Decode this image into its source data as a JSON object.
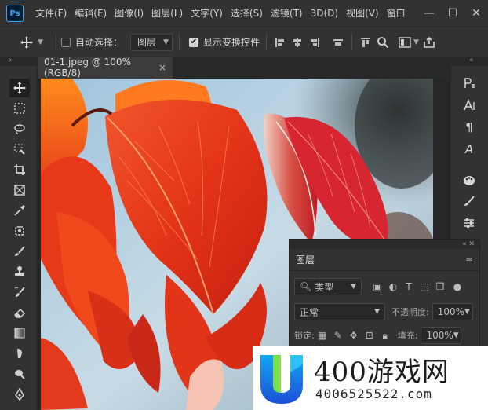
{
  "app": {
    "logo": "Ps"
  },
  "menu": [
    "文件(F)",
    "编辑(E)",
    "图像(I)",
    "图层(L)",
    "文字(Y)",
    "选择(S)",
    "滤镜(T)",
    "3D(D)",
    "视图(V)",
    "窗口"
  ],
  "window": {
    "minimize": "—",
    "restore": "☐",
    "close": "✕"
  },
  "options": {
    "auto_select_label": "自动选择：",
    "auto_select_checked": false,
    "auto_select_target": "图层",
    "show_transform_label": "显示变换控件",
    "show_transform_checked": true
  },
  "document": {
    "tab_title": "01-1.jpeg @ 100%(RGB/8)",
    "close": "×"
  },
  "layers_panel": {
    "title": "图层",
    "filter_kind": "类型",
    "blend_mode": "正常",
    "opacity_label": "不透明度:",
    "opacity_value": "100%",
    "lock_label": "锁定:",
    "fill_label": "填充:",
    "fill_value": "100%"
  },
  "watermark": {
    "brand": "400游戏网",
    "url": "4006525522.com"
  },
  "icons": {
    "tools": [
      "move-icon",
      "marquee-icon",
      "lasso-icon",
      "quick-select-icon",
      "crop-icon",
      "frame-icon",
      "eyedropper-icon",
      "patch-icon",
      "brush-icon",
      "stamp-icon",
      "history-brush-icon",
      "eraser-icon",
      "gradient-icon",
      "smudge-icon",
      "dodge-icon",
      "pen-icon"
    ],
    "right_strip": [
      "paragraph-style-icon",
      "character-icon",
      "paragraph-icon",
      "glyphs-icon",
      "color-palette-icon",
      "brushes-icon",
      "adjustments-icon"
    ]
  },
  "colors": {
    "ps_blue": "#31a8ff",
    "panel": "#323232",
    "dark": "#282828",
    "leaf_red": "#e0321c"
  }
}
